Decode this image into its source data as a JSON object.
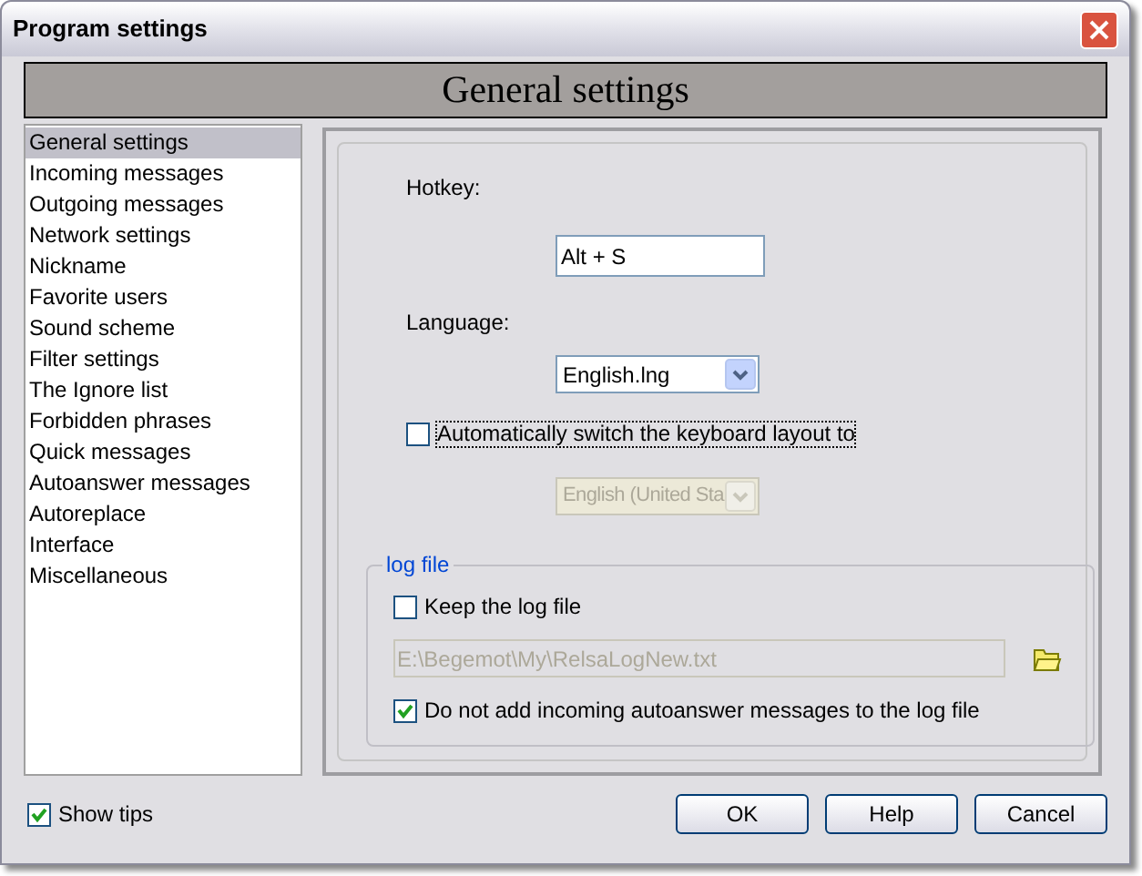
{
  "window": {
    "title": "Program settings"
  },
  "header": "General settings",
  "sidebar": {
    "items": [
      {
        "label": "General settings",
        "selected": true
      },
      {
        "label": "Incoming messages",
        "selected": false
      },
      {
        "label": "Outgoing messages",
        "selected": false
      },
      {
        "label": "Network settings",
        "selected": false
      },
      {
        "label": "Nickname",
        "selected": false
      },
      {
        "label": "Favorite users",
        "selected": false
      },
      {
        "label": "Sound scheme",
        "selected": false
      },
      {
        "label": "Filter settings",
        "selected": false
      },
      {
        "label": "The Ignore list",
        "selected": false
      },
      {
        "label": "Forbidden phrases",
        "selected": false
      },
      {
        "label": "Quick messages",
        "selected": false
      },
      {
        "label": "Autoanswer messages",
        "selected": false
      },
      {
        "label": "Autoreplace",
        "selected": false
      },
      {
        "label": "Interface",
        "selected": false
      },
      {
        "label": "Miscellaneous",
        "selected": false
      }
    ]
  },
  "hotkey": {
    "label": "Hotkey:",
    "value": "Alt + S"
  },
  "language": {
    "label": "Language:",
    "value": "English.lng"
  },
  "auto_switch": {
    "label": "Automatically switch the keyboard layout to",
    "checked": false
  },
  "layout": {
    "value": "English (United Sta",
    "disabled": true
  },
  "log_file": {
    "title": "log file",
    "keep": {
      "label": "Keep the log file",
      "checked": false
    },
    "path": {
      "value": "E:\\Begemot\\My\\RelsaLogNew.txt",
      "disabled": true
    },
    "no_autoanswer": {
      "label": "Do not add incoming autoanswer messages to the log file",
      "checked": true
    }
  },
  "show_tips": {
    "label": "Show tips",
    "checked": true
  },
  "buttons": [
    "OK",
    "Help",
    "Cancel"
  ]
}
